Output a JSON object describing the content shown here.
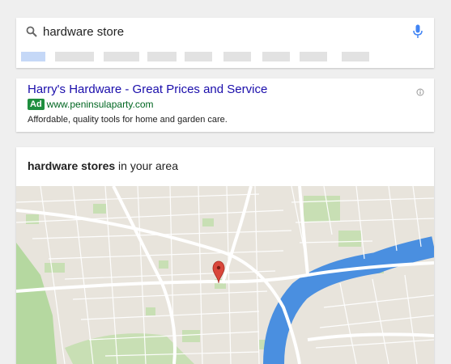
{
  "search": {
    "query": "hardware store",
    "icons": {
      "search": "search-icon",
      "mic": "microphone-icon"
    }
  },
  "ad": {
    "title": "Harry's Hardware - Great Prices and Service",
    "badge": "Ad",
    "url": "www.peninsulaparty.com",
    "description": "Affordable, quality tools for home and garden care.",
    "info_icon": "info-icon"
  },
  "local": {
    "heading_bold": "hardware stores",
    "heading_rest": " in your area",
    "map_pin_icon": "map-pin-icon"
  },
  "colors": {
    "link": "#1a0dab",
    "url_green": "#006621",
    "ad_badge": "#1e8e3e",
    "water": "#4a8fe0",
    "pin": "#d9473b",
    "google_blue": "#4285f4"
  }
}
